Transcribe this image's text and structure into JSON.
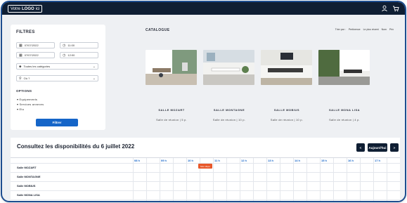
{
  "header": {
    "logo_prefix": "Votre",
    "logo_bold": "LOGO",
    "logo_suffix": "ici",
    "icons": [
      "user-icon",
      "cart-icon"
    ]
  },
  "filters": {
    "title": "FILTRES",
    "date_start": "07/07/2022",
    "time_start": "11:00",
    "date_end": "07/07/2022",
    "time_end": "12:00",
    "category": "Toutes les catégories",
    "location": "Où ?",
    "options_title": "OPTIONS",
    "options": [
      "Equipements",
      "Services annexes",
      "Etu"
    ],
    "submit_label": "Filtrer"
  },
  "catalogue": {
    "title": "CATALOGUE",
    "sort_label": "Trier par :",
    "sort_options": [
      "Pertinence",
      "Le plus récent",
      "Nom",
      "Prix"
    ],
    "rooms": [
      {
        "name": "SALLE MOZART",
        "desc": "Salle de réunion | 5 p."
      },
      {
        "name": "SALLE MONTAGNE",
        "desc": "Salle de réunion | 10 p."
      },
      {
        "name": "SALLE MOBIUS",
        "desc": "Salle de réunion | 10 p."
      },
      {
        "name": "SALLE MONA LISA",
        "desc": "Salle de réunion | 4 p."
      }
    ]
  },
  "availability": {
    "title": "Consultez les disponibilités du 6 juillet 2022",
    "prev_label": "<",
    "today_label": "Aujourd'hui",
    "next_label": ">",
    "hours": [
      "08 h",
      "09 h",
      "10 h",
      "11 h",
      "12 h",
      "13 h",
      "14 h",
      "15 h",
      "16 h",
      "17 h"
    ],
    "rows": [
      "Salle MOZART",
      "Salle MONTAGNE",
      "Salle MOBIUS",
      "Salle MONA LISA"
    ],
    "booking_label": "Mon dispo"
  },
  "colors": {
    "topbar": "#0f1e33",
    "accent": "#1565c8",
    "booking": "#e8582a"
  }
}
